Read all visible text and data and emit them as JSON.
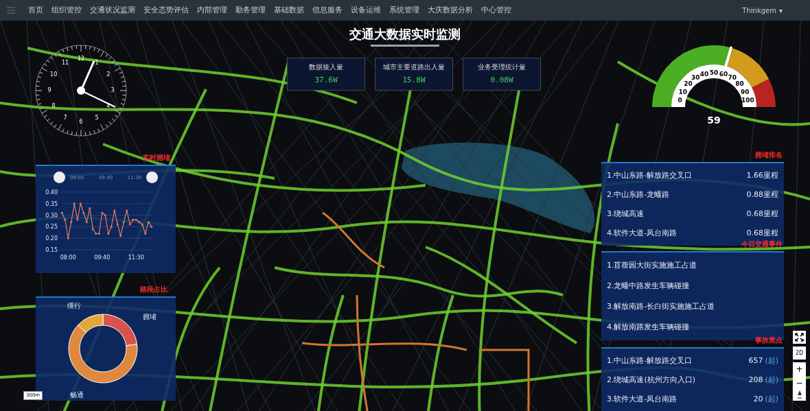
{
  "nav": {
    "items": [
      {
        "label": "首页",
        "selected": false
      },
      {
        "label": "组织管控",
        "selected": false
      },
      {
        "label": "交通状况监测",
        "selected": false
      },
      {
        "label": "安全态势评估",
        "selected": false
      },
      {
        "label": "内部管理",
        "selected": false
      },
      {
        "label": "勤务管理",
        "selected": false
      },
      {
        "label": "基础数据",
        "selected": false
      },
      {
        "label": "信息服务",
        "selected": false
      },
      {
        "label": "设备运维",
        "selected": false
      },
      {
        "label": "系统管理",
        "selected": false
      },
      {
        "label": "大庆数据分析",
        "selected": false
      },
      {
        "label": "中心管控",
        "selected": false
      }
    ],
    "user": "Thinkgem",
    "user_caret": "▾"
  },
  "title": "交通大数据实时监测",
  "stats": [
    {
      "label": "数据接入量",
      "value": "37.6W"
    },
    {
      "label": "城市主要道路出入量",
      "value": "15.8W"
    },
    {
      "label": "业务受理统计量",
      "value": "0.08W"
    }
  ],
  "clock": {
    "numbers": [
      "12",
      "1",
      "2",
      "3",
      "4",
      "5",
      "6",
      "7",
      "8",
      "9",
      "10",
      "11"
    ]
  },
  "gauge": {
    "ticks": [
      "0",
      "10",
      "20",
      "30",
      "40",
      "50",
      "60",
      "70",
      "80",
      "90",
      "100"
    ],
    "level": 0.59,
    "reading": "59"
  },
  "congestion_panel": {
    "title": "实时拥堵",
    "brush_labels": [
      "08:00",
      "09:40",
      "11:30"
    ],
    "chart_data": {
      "type": "line",
      "categories": [
        null,
        null,
        "08:00",
        null,
        null,
        null,
        null,
        null,
        null,
        null,
        null,
        null,
        null,
        "09:40",
        null,
        null,
        null,
        null,
        null,
        null,
        null,
        null,
        null,
        null,
        "11:30",
        null,
        null,
        null,
        null,
        null
      ],
      "series": [
        {
          "color": "#e07a5f",
          "values": [
            0.31,
            0.28,
            0.2,
            0.27,
            0.35,
            0.28,
            0.35,
            0.31,
            0.27,
            0.33,
            0.24,
            0.22,
            0.22,
            0.31,
            0.3,
            0.22,
            0.25,
            0.32,
            0.26,
            0.21,
            0.27,
            0.32,
            0.26,
            0.28,
            0.28,
            0.27,
            0.26,
            0.22,
            0.27,
            0.25
          ]
        }
      ],
      "ylim": [
        0.15,
        0.4
      ],
      "yticks": [
        {
          "value": 0.15,
          "label": "0.15"
        },
        {
          "value": 0.2,
          "label": "0.20"
        },
        {
          "value": 0.25,
          "label": "0.25"
        },
        {
          "value": 0.3,
          "label": "0.30"
        },
        {
          "value": 0.35,
          "label": "0.35"
        },
        {
          "value": 0.4,
          "label": "0.40"
        }
      ],
      "grid": true
    }
  },
  "share_panel": {
    "title": "路段占比",
    "labels": [
      "缓行",
      "拥堵",
      "畅通"
    ]
  },
  "scale_label": "300m",
  "ranking": {
    "title": "拥堵排名",
    "rows": [
      {
        "name": "1.中山东路-解放路交叉口",
        "value": "1.66里程"
      },
      {
        "name": "2.中山东路-龙蟠路",
        "value": "0.88里程"
      },
      {
        "name": "3.绕城高速",
        "value": "0.68里程"
      },
      {
        "name": "4.软件大道-凤台南路",
        "value": "0.68里程"
      }
    ]
  },
  "events": {
    "title": "今日交通事件",
    "rows": [
      "1.苜蓿园大街实施施工占道",
      "2.龙蟠中路发生车辆碰撞",
      "3.解放南路-长白街实施施工占道",
      "4.解放南路发生车辆碰撞"
    ]
  },
  "blackspots": {
    "title": "事故黑点",
    "rows": [
      {
        "name": "1.中山东路-解放路交叉口",
        "count": "657",
        "unit": "(起)"
      },
      {
        "name": "2.绕城高速(杭州方向入口)",
        "count": "208",
        "unit": "(起)"
      },
      {
        "name": "3.软件大道-凤台南路",
        "count": "20",
        "unit": "(起)"
      }
    ]
  },
  "map_controls": {
    "mode": "2D",
    "zoom_in": "+",
    "zoom_out": "−"
  }
}
